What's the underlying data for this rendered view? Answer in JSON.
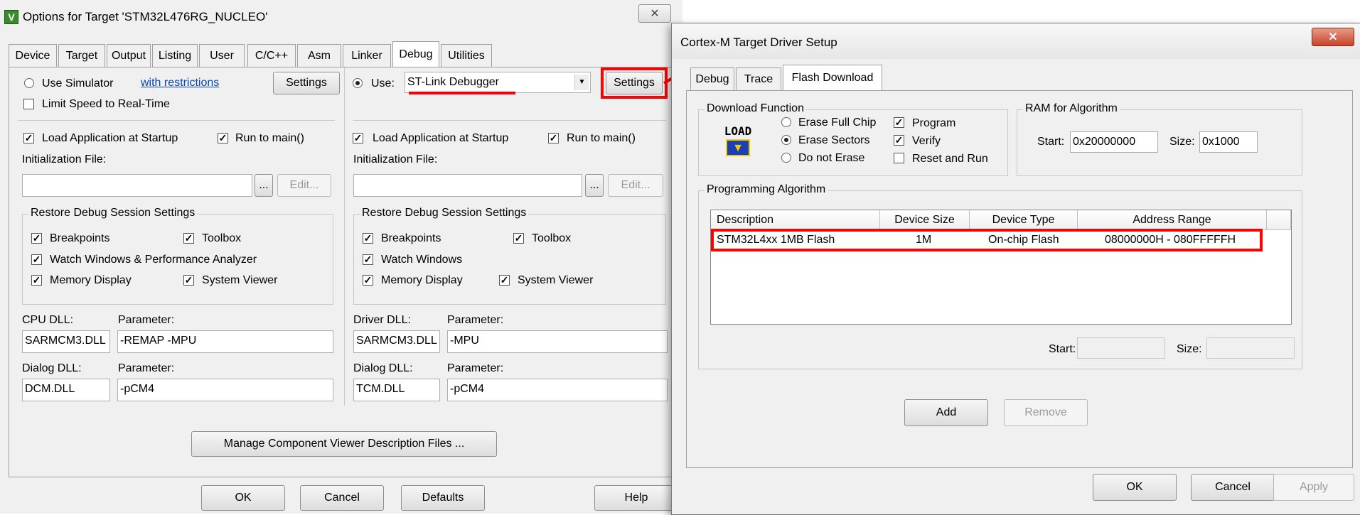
{
  "options_dialog": {
    "title": "Options for Target 'STM32L476RG_NUCLEO'",
    "close_glyph": "✕",
    "tabs": [
      "Device",
      "Target",
      "Output",
      "Listing",
      "User",
      "C/C++",
      "Asm",
      "Linker",
      "Debug",
      "Utilities"
    ],
    "active_tab": "Debug",
    "left": {
      "use_simulator": "Use Simulator",
      "with_restrictions": "with restrictions",
      "settings": "Settings",
      "limit_speed": "Limit Speed to Real-Time",
      "load_app": "Load Application at Startup",
      "run_to_main": "Run to main()",
      "init_file_label": "Initialization File:",
      "browse": "...",
      "edit": "Edit...",
      "restore_group": "Restore Debug Session Settings",
      "breakpoints": "Breakpoints",
      "toolbox": "Toolbox",
      "watch_windows": "Watch Windows & Performance Analyzer",
      "memory_display": "Memory Display",
      "system_viewer": "System Viewer",
      "cpu_dll_label": "CPU DLL:",
      "parameter_label": "Parameter:",
      "cpu_dll": "SARMCM3.DLL",
      "cpu_param": "-REMAP -MPU",
      "dialog_dll_label": "Dialog DLL:",
      "dialog_dll": "DCM.DLL",
      "dialog_param": "-pCM4"
    },
    "right": {
      "use": "Use:",
      "debugger": "ST-Link Debugger",
      "settings": "Settings",
      "load_app": "Load Application at Startup",
      "run_to_main": "Run to main()",
      "init_file_label": "Initialization File:",
      "browse": "...",
      "edit": "Edit...",
      "restore_group": "Restore Debug Session Settings",
      "breakpoints": "Breakpoints",
      "toolbox": "Toolbox",
      "watch_windows": "Watch Windows",
      "memory_display": "Memory Display",
      "system_viewer": "System Viewer",
      "driver_dll_label": "Driver DLL:",
      "parameter_label": "Parameter:",
      "driver_dll": "SARMCM3.DLL",
      "driver_param": "-MPU",
      "dialog_dll_label": "Dialog DLL:",
      "dialog_dll": "TCM.DLL",
      "dialog_param": "-pCM4"
    },
    "manage_button": "Manage Component Viewer Description Files ...",
    "buttons": {
      "ok": "OK",
      "cancel": "Cancel",
      "defaults": "Defaults",
      "help": "Help"
    }
  },
  "driver_dialog": {
    "title": "Cortex-M Target Driver Setup",
    "close_glyph": "✕",
    "tabs": [
      "Debug",
      "Trace",
      "Flash Download"
    ],
    "active_tab": "Flash Download",
    "download_function": {
      "title": "Download Function",
      "icon_text": "LOAD",
      "erase_full_chip": "Erase Full Chip",
      "erase_sectors": "Erase Sectors",
      "do_not_erase": "Do not Erase",
      "program": "Program",
      "verify": "Verify",
      "reset_and_run": "Reset and Run"
    },
    "ram": {
      "title": "RAM for Algorithm",
      "start_label": "Start:",
      "start": "0x20000000",
      "size_label": "Size:",
      "size": "0x1000"
    },
    "programming_algorithm": {
      "title": "Programming Algorithm",
      "columns": [
        "Description",
        "Device Size",
        "Device Type",
        "Address Range"
      ],
      "rows": [
        [
          "STM32L4xx 1MB Flash",
          "1M",
          "On-chip Flash",
          "08000000H - 080FFFFFH"
        ]
      ],
      "start_label": "Start:",
      "size_label": "Size:"
    },
    "add": "Add",
    "remove": "Remove",
    "buttons": {
      "ok": "OK",
      "cancel": "Cancel",
      "apply": "Apply"
    }
  },
  "annotation_color": "#ff0000"
}
